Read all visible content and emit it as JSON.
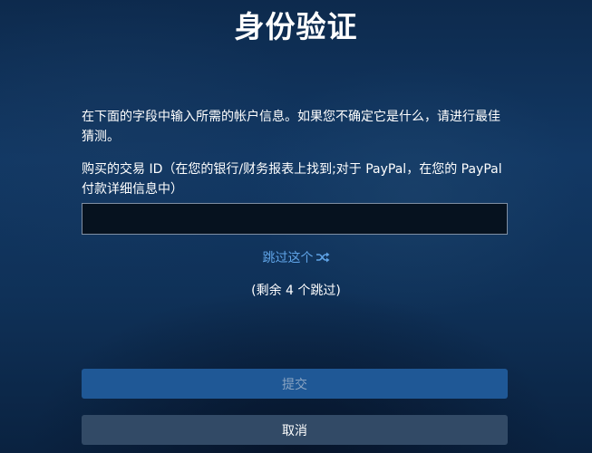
{
  "header": {
    "title": "身份验证"
  },
  "form": {
    "intro": "在下面的字段中输入所需的帐户信息。如果您不确定它是什么，请进行最佳猜测。",
    "field_label": "购买的交易 ID（在您的银行/财务报表上找到;对于 PayPal，在您的 PayPal 付款详细信息中）",
    "field_value": "",
    "skip_label": "跳过这个",
    "skip_icon": "shuffle-icon",
    "remaining_text": "(剩余 4 个跳过)"
  },
  "actions": {
    "submit_label": "提交",
    "cancel_label": "取消"
  },
  "colors": {
    "link": "#5fa3e6",
    "submit_bg": "#1f5896",
    "cancel_bg": "#324a66"
  }
}
